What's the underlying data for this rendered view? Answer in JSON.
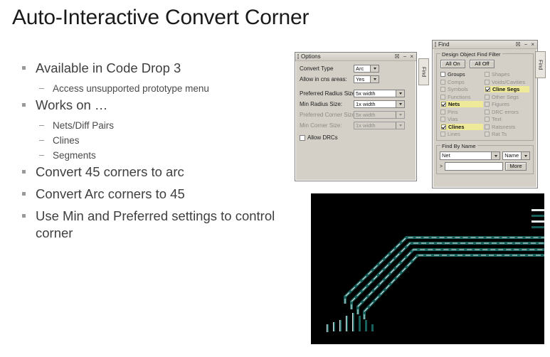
{
  "slide": {
    "title": "Auto-Interactive Convert Corner",
    "bullets": [
      {
        "level": 1,
        "text": "Available in Code Drop 3"
      },
      {
        "level": 2,
        "text": "Access unsupported prototype menu"
      },
      {
        "level": 1,
        "text": "Works on …"
      },
      {
        "level": 2,
        "text": "Nets/Diff Pairs"
      },
      {
        "level": 2,
        "text": "Clines"
      },
      {
        "level": 2,
        "text": "Segments"
      },
      {
        "level": 1,
        "text": "Convert 45 corners to arc"
      },
      {
        "level": 1,
        "text": "Convert Arc corners to 45"
      },
      {
        "level": 1,
        "text": "Use Min and Preferred settings to control corner"
      }
    ]
  },
  "options_dialog": {
    "title": "Options",
    "title_buttons": [
      "pin-icon",
      "minimize-icon",
      "close-icon"
    ],
    "fields": [
      {
        "label": "Convert Type",
        "value": "Arc",
        "disabled": false,
        "width": "narrow"
      },
      {
        "label": "Allow in cns areas:",
        "value": "Yes",
        "disabled": false,
        "width": "narrow"
      },
      {
        "label": "Preferred Radius Size:",
        "value": "5x width",
        "disabled": false,
        "width": "wide"
      },
      {
        "label": "Min Radius Size:",
        "value": "1x width",
        "disabled": false,
        "width": "wide"
      },
      {
        "label": "Preferred Corner Size:",
        "value": "5x width",
        "disabled": true,
        "width": "wide"
      },
      {
        "label": "Min Corner Size:",
        "value": "1x width",
        "disabled": true,
        "width": "wide"
      }
    ],
    "allow_drcs": {
      "label": "Allow DRCs",
      "checked": false
    }
  },
  "find_dialog": {
    "title": "Find",
    "title_buttons": [
      "pin-icon",
      "minimize-icon",
      "close-icon"
    ],
    "filter_group": {
      "caption": "Design Object Find Filter",
      "all_on": "All On",
      "all_off": "All Off",
      "items": [
        {
          "label": "Groups",
          "checked": false,
          "disabled": false,
          "highlighted": false
        },
        {
          "label": "Shapes",
          "checked": false,
          "disabled": true,
          "highlighted": false
        },
        {
          "label": "Comps",
          "checked": false,
          "disabled": true,
          "highlighted": false
        },
        {
          "label": "Voids/Cavities",
          "checked": false,
          "disabled": true,
          "highlighted": false
        },
        {
          "label": "Symbols",
          "checked": false,
          "disabled": true,
          "highlighted": false
        },
        {
          "label": "Cline Segs",
          "checked": true,
          "disabled": false,
          "highlighted": true
        },
        {
          "label": "Functions",
          "checked": false,
          "disabled": true,
          "highlighted": false
        },
        {
          "label": "Other Segs",
          "checked": false,
          "disabled": true,
          "highlighted": false
        },
        {
          "label": "Nets",
          "checked": true,
          "disabled": false,
          "highlighted": true
        },
        {
          "label": "Figures",
          "checked": false,
          "disabled": true,
          "highlighted": false
        },
        {
          "label": "Pins",
          "checked": false,
          "disabled": true,
          "highlighted": false
        },
        {
          "label": "DRC errors",
          "checked": false,
          "disabled": true,
          "highlighted": false
        },
        {
          "label": "Vias",
          "checked": false,
          "disabled": true,
          "highlighted": false
        },
        {
          "label": "Text",
          "checked": false,
          "disabled": true,
          "highlighted": false
        },
        {
          "label": "Clines",
          "checked": true,
          "disabled": false,
          "highlighted": true
        },
        {
          "label": "Ratsnests",
          "checked": false,
          "disabled": true,
          "highlighted": false
        },
        {
          "label": "Lines",
          "checked": false,
          "disabled": true,
          "highlighted": false
        },
        {
          "label": "Rat Ts",
          "checked": false,
          "disabled": true,
          "highlighted": false
        }
      ]
    },
    "find_by_name": {
      "caption": "Find By Name",
      "object_type": "Net",
      "match_by": "Name",
      "name_value": ""
    }
  },
  "dock_tabs": [
    {
      "label": "Find"
    },
    {
      "label": "Find"
    }
  ],
  "canvas": {
    "name": "pcb-routing-canvas",
    "background": "#000000",
    "trace_color": "#1f6a66",
    "highlight_color": "#ffffff",
    "trace_count": 4,
    "corner_style": "45"
  },
  "colors": {
    "dialog_face": "#d4d0c8",
    "highlight_yellow": "#eeea9a",
    "title_text": "#1a1a1a",
    "bullet_text": "#3f3f3f",
    "canvas_bg": "#000000",
    "trace_teal": "#1f6a66"
  }
}
